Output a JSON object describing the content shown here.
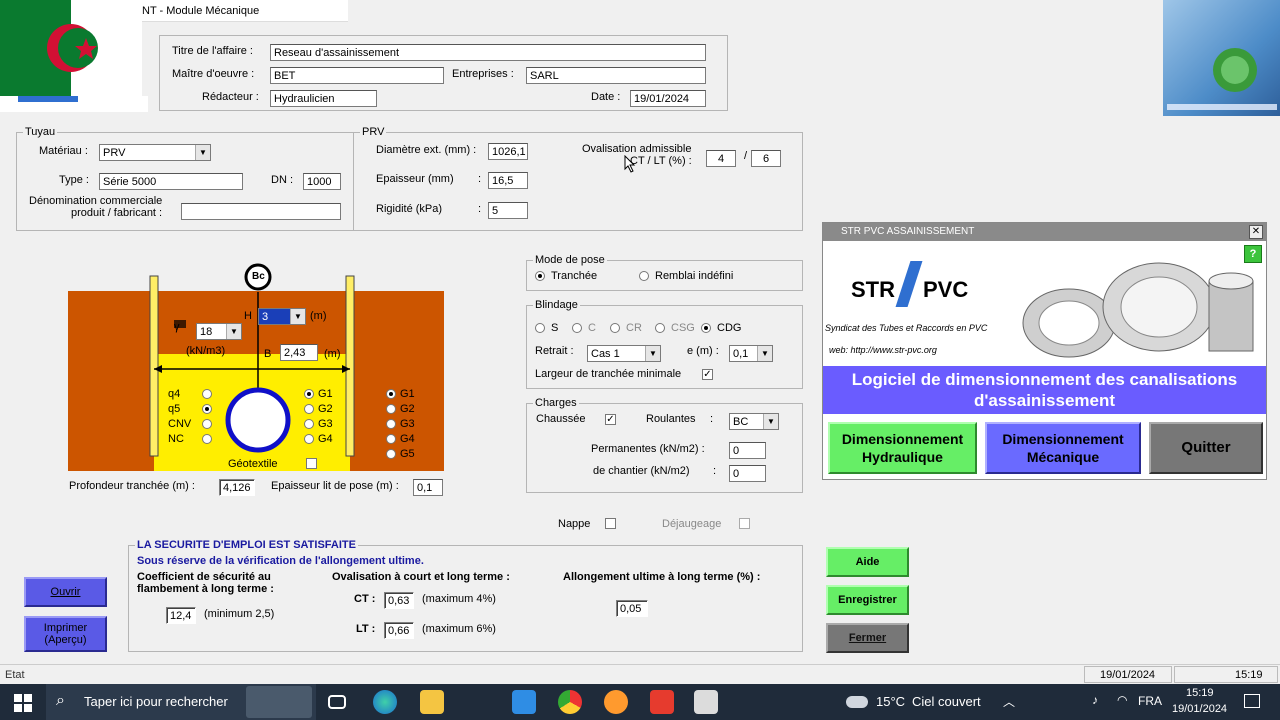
{
  "window": {
    "title": "NT - Module Mécanique"
  },
  "affaire": {
    "titre_label": "Titre de l'affaire :",
    "titre_value": "Reseau d'assainissement",
    "maitre_label": "Maître d'oeuvre :",
    "maitre_value": "BET",
    "entreprises_label": "Entreprises :",
    "entreprises_value": "SARL",
    "redacteur_label": "Rédacteur :",
    "redacteur_value": "Hydraulicien",
    "date_label": "Date :",
    "date_value": "19/01/2024"
  },
  "tuyau": {
    "group_title": "Tuyau",
    "materiau_label": "Matériau :",
    "materiau_value": "PRV",
    "type_label": "Type :",
    "type_value": "Série 5000",
    "dn_label": "DN :",
    "dn_value": "1000",
    "denom_label_1": "Dénomination commerciale",
    "denom_label_2": "produit / fabricant :",
    "denom_value": ""
  },
  "prv": {
    "group_title": "PRV",
    "diametre_label": "Diamètre ext. (mm) :",
    "diametre_value": "1026,1",
    "epaisseur_label": "Epaisseur (mm)",
    "epaisseur_sep": ":",
    "epaisseur_value": "16,5",
    "rigidite_label": "Rigidité (kPa)",
    "rigidite_sep": ":",
    "rigidite_value": "5",
    "ovalisation_label_1": "Ovalisation admissible",
    "ovalisation_label_2": "CT / LT (%) :",
    "ovalisation_ct": "4",
    "ovalisation_sep": "/",
    "ovalisation_lt": "6"
  },
  "schema": {
    "bc_label": "Bc",
    "h_label": "H",
    "h_value": "3",
    "h_unit": "(m)",
    "b_label": "B",
    "b_value": "2,43",
    "b_unit": "(m)",
    "gamma_value": "18",
    "gamma_unit": "(kN/m3)",
    "left_options": [
      "q4",
      "q5",
      "CNV",
      "NC"
    ],
    "left_selected": 1,
    "mid_options": [
      "G1",
      "G2",
      "G3",
      "G4"
    ],
    "mid_selected": 0,
    "right_options": [
      "G1",
      "G2",
      "G3",
      "G4",
      "G5"
    ],
    "right_selected": 0,
    "geotextile_label": "Géotextile",
    "profondeur_label": "Profondeur tranchée (m) :",
    "profondeur_value": "4,126",
    "epaisseur_lit_label": "Epaisseur lit de pose (m) :",
    "epaisseur_lit_value": "0,1"
  },
  "mode_pose": {
    "group_title": "Mode de pose",
    "options": [
      "Tranchée",
      "Remblai indéfini"
    ],
    "selected": 0
  },
  "blindage": {
    "group_title": "Blindage",
    "options": [
      "S",
      "C",
      "CR",
      "CSG",
      "CDG"
    ],
    "selected": 4,
    "retrait_label": "Retrait :",
    "retrait_value": "Cas 1",
    "e_label": "e (m) :",
    "e_value": "0,1",
    "largeur_label": "Largeur de tranchée minimale",
    "largeur_checked": "✓"
  },
  "charges": {
    "group_title": "Charges",
    "chaussee_label": "Chaussée",
    "chaussee_checked": "✓",
    "roulantes_label": "Roulantes",
    "roulantes_sep": ":",
    "roulantes_value": "BC",
    "permanentes_label": "Permanentes (kN/m2) :",
    "permanentes_value": "0",
    "chantier_label": "de chantier (kN/m2)",
    "chantier_sep": ":",
    "chantier_value": "0"
  },
  "nappe": {
    "nappe_label": "Nappe",
    "dejaugeage_label": "Déjaugeage"
  },
  "resultats": {
    "status": "LA SECURITE D'EMPLOI EST SATISFAITE",
    "note": "Sous réserve de la vérification de l'allongement ultime.",
    "coef_label_1": "Coefficient de sécurité au",
    "coef_label_2": "flambement à long terme :",
    "coef_value": "12,4",
    "coef_min": "(minimum 2,5)",
    "oval_label": "Ovalisation à court et long terme :",
    "ct_label": "CT :",
    "ct_value": "0,63",
    "ct_max": "(maximum 4%)",
    "lt_label": "LT :",
    "lt_value": "0,66",
    "lt_max": "(maximum 6%)",
    "allong_label": "Allongement ultime à long terme (%) :",
    "allong_value": "0,05"
  },
  "buttons": {
    "ouvrir": "Ouvrir",
    "imprimer_1": "Imprimer",
    "imprimer_2": "(Aperçu)",
    "aide": "Aide",
    "enregistrer": "Enregistrer",
    "fermer": "Fermer"
  },
  "statusbar": {
    "etat": "Etat",
    "date": "19/01/2024",
    "time": "15:19"
  },
  "str_window": {
    "title": "STR PVC ASSAINISSEMENT",
    "close": "✕",
    "help": "?",
    "logo_str": "STR",
    "logo_pvc": "PVC",
    "syndicat": "Syndicat des Tubes et Raccords en PVC",
    "web": "web: http://www.str-pvc.org",
    "banner": "Logiciel de dimensionnement des canalisations d'assainissement",
    "btn_hydraulique_1": "Dimensionnement",
    "btn_hydraulique_2": "Hydraulique",
    "btn_mecanique_1": "Dimensionnement",
    "btn_mecanique_2": "Mécanique",
    "btn_quitter": "Quitter"
  },
  "taskbar": {
    "search_placeholder": "Taper ici pour rechercher",
    "weather_temp": "15°C",
    "weather_text": "Ciel couvert",
    "lang": "FRA",
    "time": "15:19",
    "date": "19/01/2024"
  },
  "colors": {
    "earth": "#cc5500",
    "backfill": "#ffee00",
    "pipe_ring": "#1010c8",
    "blue_button": "#5a5ae6",
    "green_button": "#66ee66",
    "banner": "#6a5cff",
    "status_blue": "#1a1aa0"
  }
}
